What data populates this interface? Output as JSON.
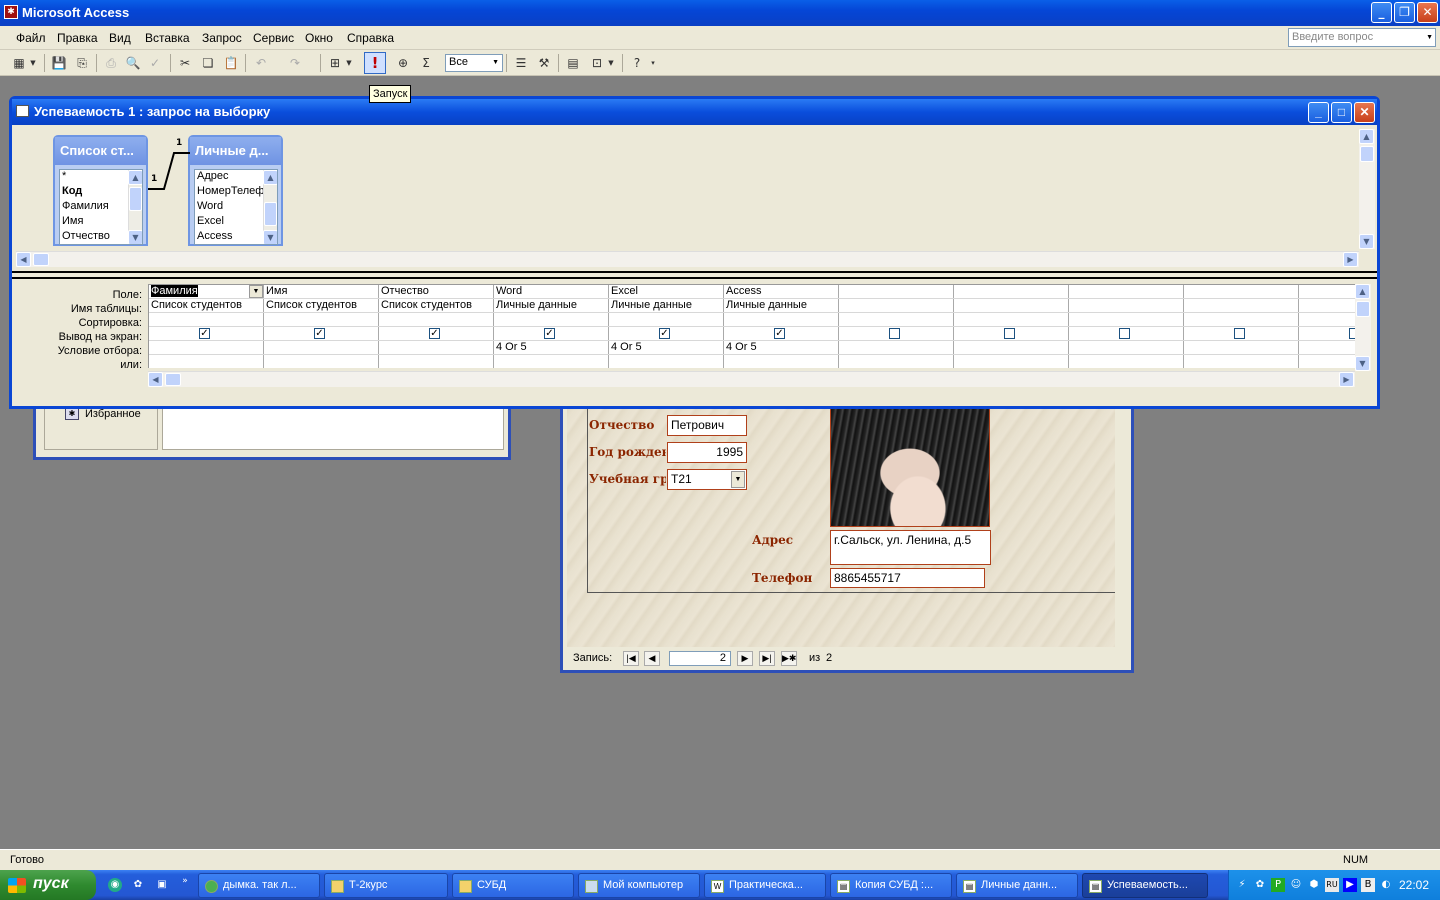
{
  "app": {
    "title": "Microsoft Access"
  },
  "menu": [
    "Файл",
    "Правка",
    "Вид",
    "Вставка",
    "Запрос",
    "Сервис",
    "Окно",
    "Справка"
  ],
  "help_box": {
    "placeholder": "Введите вопрос"
  },
  "toolbar": {
    "top_values": "Все",
    "run_tooltip": "Запуск",
    "icons": [
      "view-icon",
      "save-icon",
      "print-icon",
      "preview-icon",
      "spell-icon",
      "cut-icon",
      "copy-icon",
      "paste-icon",
      "undo-icon",
      "redo-icon",
      "query-type-icon",
      "run-icon",
      "show-table-icon",
      "totals-icon",
      "properties-icon",
      "build-icon",
      "database-window-icon",
      "new-object-icon",
      "help-icon"
    ]
  },
  "query_window": {
    "title": "Успеваемость 1 : запрос на выборку",
    "tables": [
      {
        "name": "Список ст...",
        "fields": [
          "*",
          "Код",
          "Фамилия",
          "Имя",
          "Отчество"
        ]
      },
      {
        "name": "Личные д...",
        "fields": [
          "Адрес",
          "НомерТелефо",
          "Word",
          "Excel",
          "Access"
        ]
      }
    ],
    "relation": {
      "left": "1",
      "right": "1"
    },
    "row_labels": [
      "Поле:",
      "Имя таблицы:",
      "Сортировка:",
      "Вывод на экран:",
      "Условие отбора:",
      "или:"
    ],
    "columns": [
      {
        "field": "Фамилия",
        "table": "Список студентов",
        "show": true,
        "criteria": ""
      },
      {
        "field": "Имя",
        "table": "Список студентов",
        "show": true,
        "criteria": ""
      },
      {
        "field": "Отчество",
        "table": "Список студентов",
        "show": true,
        "criteria": ""
      },
      {
        "field": "Word",
        "table": "Личные данные",
        "show": true,
        "criteria": "4 Or 5"
      },
      {
        "field": "Excel",
        "table": "Личные данные",
        "show": true,
        "criteria": "4 Or 5"
      },
      {
        "field": "Access",
        "table": "Личные данные",
        "show": true,
        "criteria": "4 Or 5"
      },
      {
        "field": "",
        "table": "",
        "show": false,
        "criteria": ""
      },
      {
        "field": "",
        "table": "",
        "show": false,
        "criteria": ""
      },
      {
        "field": "",
        "table": "",
        "show": false,
        "criteria": ""
      },
      {
        "field": "",
        "table": "",
        "show": false,
        "criteria": ""
      },
      {
        "field": "",
        "table": "",
        "show": false,
        "criteria": ""
      }
    ]
  },
  "db_window": {
    "favorites": "Избранное"
  },
  "form_window": {
    "labels": {
      "patronymic": "Отчество",
      "birth_year": "Год рождения",
      "group": "Учебная груп",
      "address": "Адрес",
      "phone": "Телефон"
    },
    "values": {
      "patronymic": "Петрович",
      "birth_year": "1995",
      "group": "Т21",
      "address": "г.Сальск, ул. Ленина, д.5",
      "phone": "8865455717"
    },
    "nav": {
      "label": "Запись:",
      "current": "2",
      "of_label": "из",
      "total": "2"
    }
  },
  "status": {
    "text": "Готово",
    "num": "NUM"
  },
  "taskbar": {
    "start": "пуск",
    "tasks": [
      "дымка. так л...",
      "Т-2курс",
      "СУБД",
      "Мой компьютер",
      "Практическа...",
      "Копия СУБД :...",
      "Личные данн...",
      "Успеваемость..."
    ],
    "tray": {
      "lang": "RU",
      "clock": "22:02"
    }
  }
}
